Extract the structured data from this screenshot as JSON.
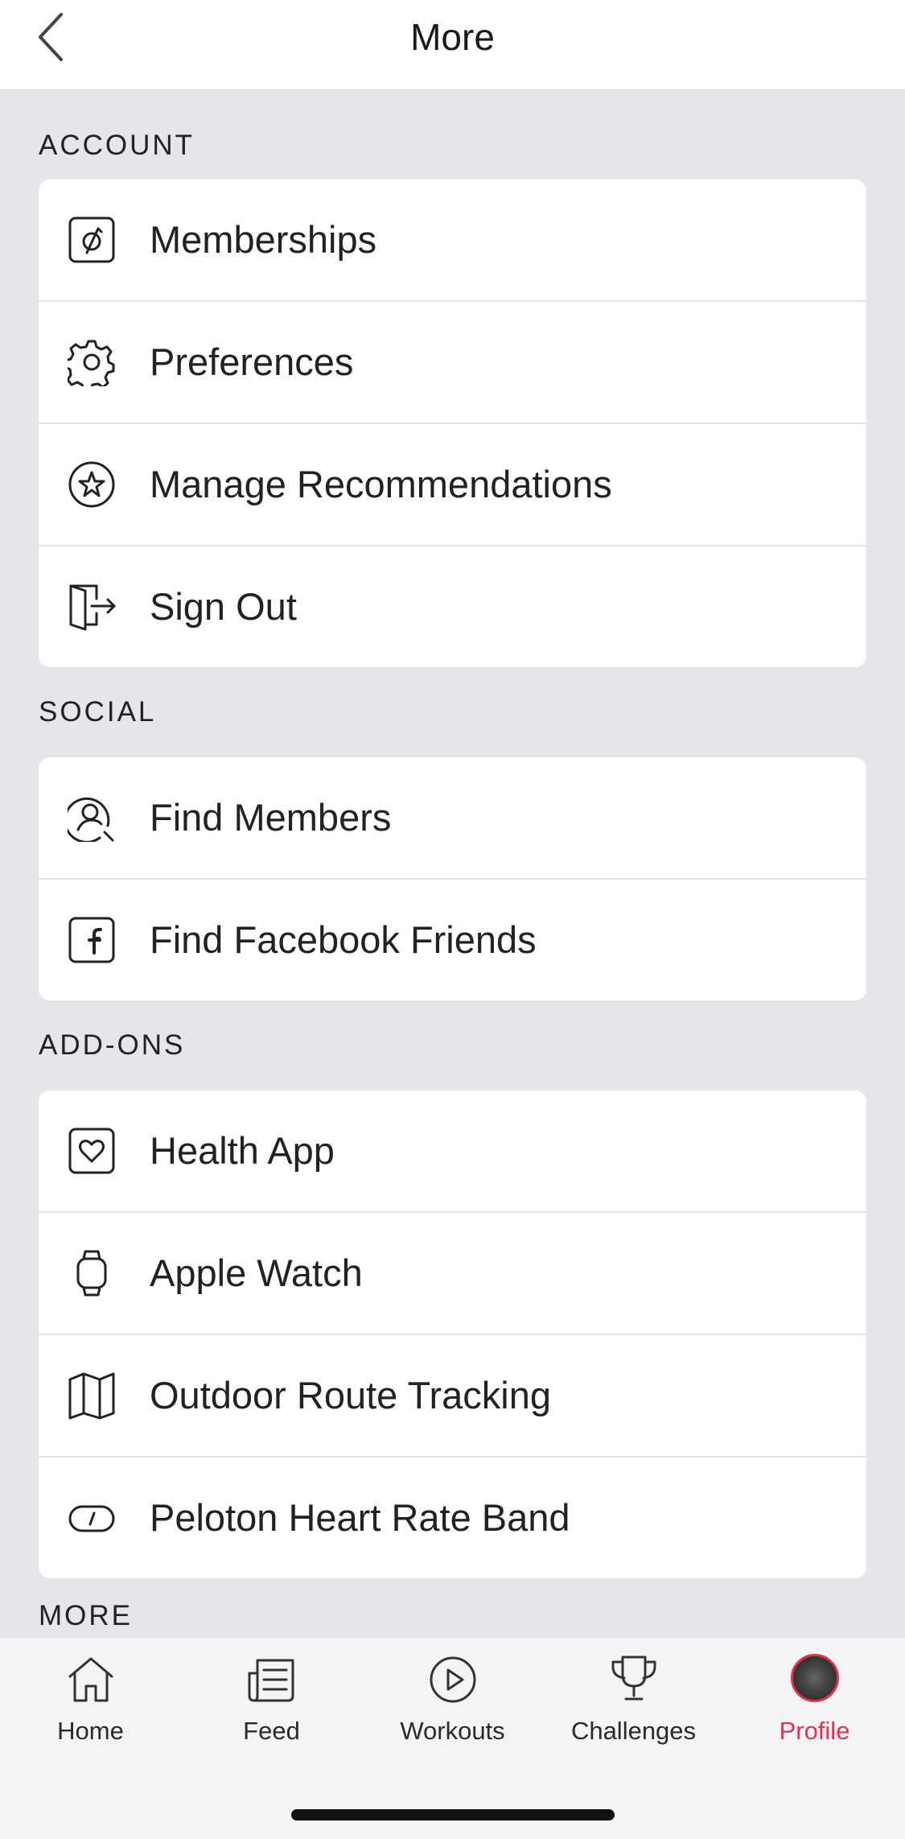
{
  "header": {
    "title": "More"
  },
  "sections": [
    {
      "title": "ACCOUNT",
      "items": [
        {
          "label": "Memberships",
          "icon": "peloton-logo-icon"
        },
        {
          "label": "Preferences",
          "icon": "gear-icon"
        },
        {
          "label": "Manage Recommendations",
          "icon": "star-icon"
        },
        {
          "label": "Sign Out",
          "icon": "sign-out-icon"
        }
      ]
    },
    {
      "title": "SOCIAL",
      "items": [
        {
          "label": "Find Members",
          "icon": "find-person-icon"
        },
        {
          "label": "Find Facebook Friends",
          "icon": "facebook-icon"
        }
      ]
    },
    {
      "title": "ADD-ONS",
      "items": [
        {
          "label": "Health App",
          "icon": "heart-icon"
        },
        {
          "label": "Apple Watch",
          "icon": "watch-icon"
        },
        {
          "label": "Outdoor Route Tracking",
          "icon": "map-icon"
        },
        {
          "label": "Peloton Heart Rate Band",
          "icon": "heart-rate-band-icon"
        }
      ]
    },
    {
      "title": "MORE"
    }
  ],
  "tabbar": {
    "items": [
      {
        "label": "Home",
        "icon": "home-icon"
      },
      {
        "label": "Feed",
        "icon": "feed-icon"
      },
      {
        "label": "Workouts",
        "icon": "play-icon"
      },
      {
        "label": "Challenges",
        "icon": "trophy-icon"
      },
      {
        "label": "Profile",
        "icon": "avatar"
      }
    ],
    "active": "Profile"
  },
  "colors": {
    "accent": "#e5324c",
    "background": "#e5e6ea",
    "card": "#ffffff"
  }
}
